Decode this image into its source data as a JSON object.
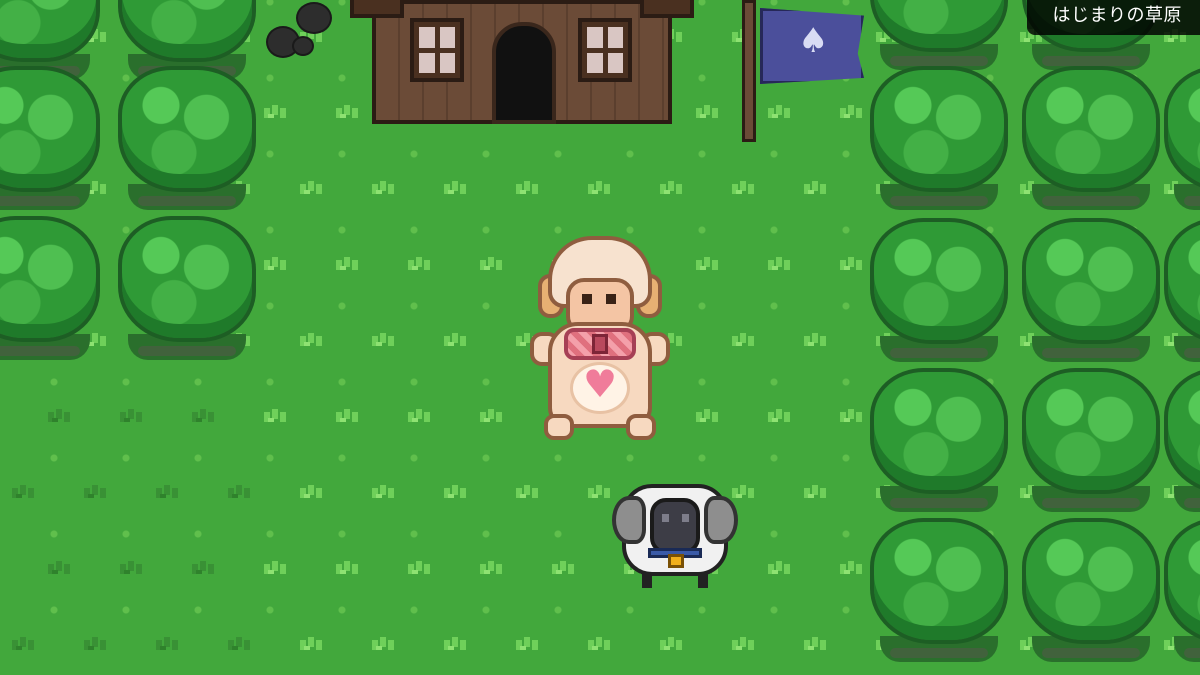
{
  "hud": {
    "location_name": "はじまりの草原"
  },
  "scene": {
    "icons": [
      "house",
      "flag",
      "rocks",
      "trees",
      "player-character",
      "sheep",
      "heart",
      "bell"
    ],
    "colors": {
      "grass": "#42a83c",
      "tree_canopy": "#2f9a36",
      "flag": "#4b4f9b",
      "house_wall": "#6b4b37"
    }
  },
  "player": {
    "emblem": "♥"
  },
  "flag": {
    "emblem": "♠"
  }
}
